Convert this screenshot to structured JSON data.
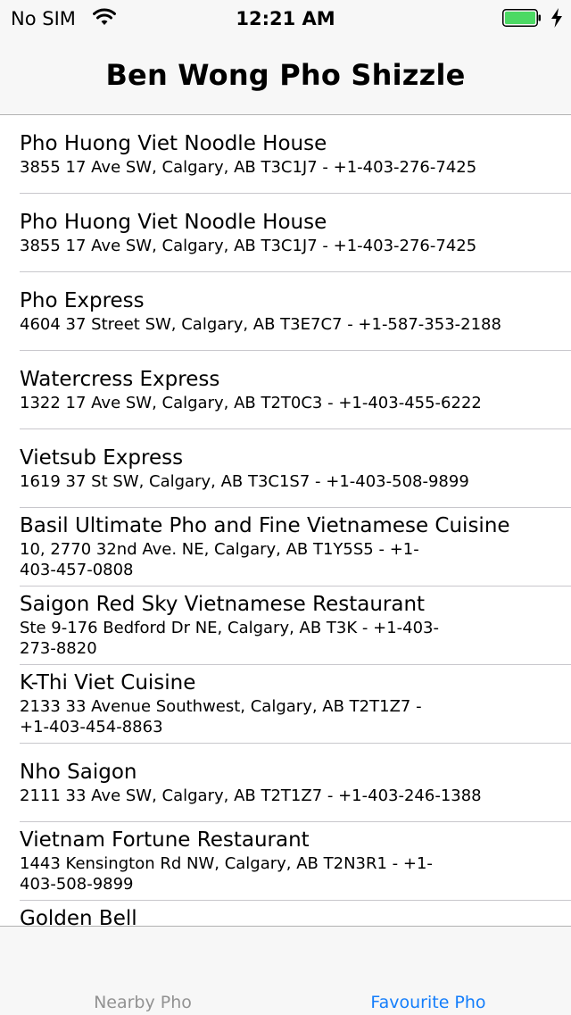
{
  "status_bar": {
    "carrier": "No SIM",
    "time": "12:21 AM",
    "battery_color": "#4cd964"
  },
  "nav": {
    "title": "Ben Wong Pho Shizzle"
  },
  "restaurants": [
    {
      "name": "Pho Huong Viet Noodle House",
      "detail": "3855 17 Ave SW, Calgary, AB T3C1J7 - +1-403-276-7425"
    },
    {
      "name": "Pho Huong Viet Noodle House",
      "detail": "3855 17 Ave SW, Calgary, AB T3C1J7 - +1-403-276-7425"
    },
    {
      "name": "Pho Express",
      "detail": "4604 37 Street SW, Calgary, AB T3E7C7 - +1-587-353-2188"
    },
    {
      "name": "Watercress Express",
      "detail": "1322 17 Ave SW, Calgary, AB T2T0C3 - +1-403-455-6222"
    },
    {
      "name": "Vietsub Express",
      "detail": "1619 37 St SW, Calgary, AB T3C1S7 - +1-403-508-9899"
    },
    {
      "name": "Basil Ultimate Pho and Fine Vietnamese Cuisine",
      "detail": "10, 2770 32nd Ave. NE, Calgary, AB T1Y5S5 - +1-403-457-0808"
    },
    {
      "name": "Saigon Red Sky Vietnamese Restaurant",
      "detail": "Ste 9-176 Bedford Dr NE, Calgary, AB T3K - +1-403-273-8820"
    },
    {
      "name": "K-Thi Viet Cuisine",
      "detail": "2133 33 Avenue Southwest, Calgary, AB T2T1Z7 - +1-403-454-8863"
    },
    {
      "name": "Nho Saigon",
      "detail": "2111 33 Ave SW, Calgary, AB T2T1Z7 - +1-403-246-1388"
    },
    {
      "name": "Vietnam Fortune Restaurant",
      "detail": "1443 Kensington Rd NW, Calgary, AB T2N3R1 - +1-403-508-9899"
    },
    {
      "name": "Golden Bell",
      "detail": ""
    }
  ],
  "tabs": [
    {
      "label": "Nearby Pho",
      "selected": false
    },
    {
      "label": "Favourite Pho",
      "selected": true
    }
  ],
  "colors": {
    "accent": "#147efb",
    "inactive_tab": "#929292"
  },
  "icons": {
    "wifi": "wifi-icon",
    "battery": "battery-icon",
    "charging": "charging-bolt-icon"
  }
}
